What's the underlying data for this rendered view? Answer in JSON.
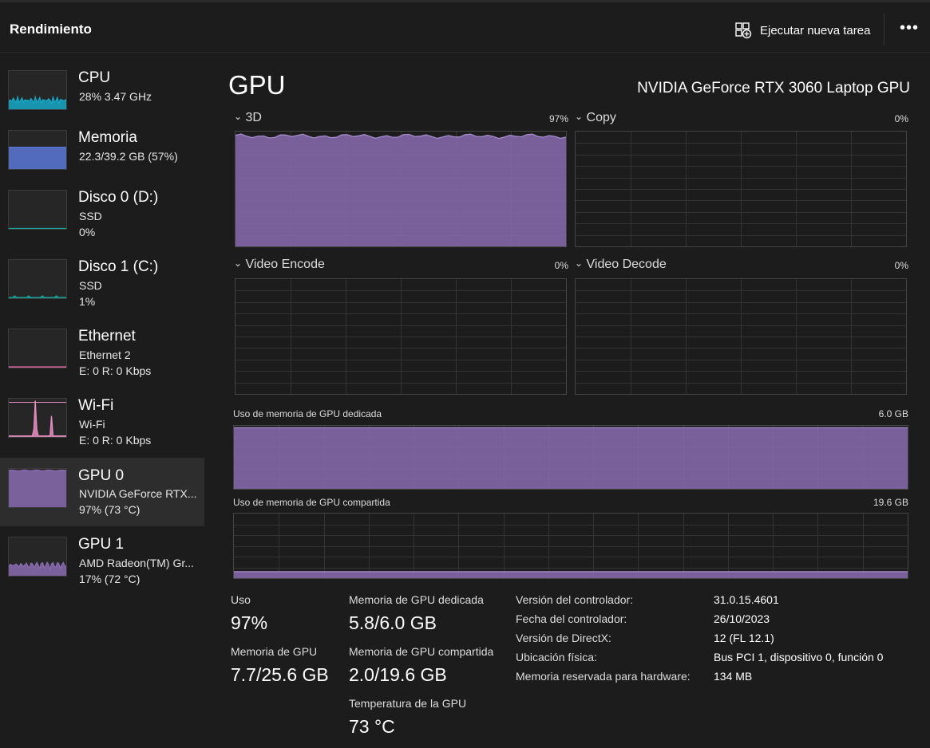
{
  "header": {
    "title": "Rendimiento",
    "new_task_label": "Ejecutar nueva tarea",
    "more_label": "•••"
  },
  "sidebar": {
    "items": [
      {
        "name": "CPU",
        "line1": "28%  3.47 GHz",
        "line2": "",
        "color": "#17a8c8"
      },
      {
        "name": "Memoria",
        "line1": "22.3/39.2 GB (57%)",
        "line2": "",
        "color": "#5b78d8"
      },
      {
        "name": "Disco 0 (D:)",
        "line1": "SSD",
        "line2": "0%",
        "color": "#1aa39a"
      },
      {
        "name": "Disco 1 (C:)",
        "line1": "SSD",
        "line2": "1%",
        "color": "#1aa39a"
      },
      {
        "name": "Ethernet",
        "line1": "Ethernet 2",
        "line2": "E: 0 R: 0 Kbps",
        "color": "#d46aa4"
      },
      {
        "name": "Wi-Fi",
        "line1": "Wi-Fi",
        "line2": "E: 0 R: 0 Kbps",
        "color": "#e48fc0"
      },
      {
        "name": "GPU 0",
        "line1": "NVIDIA GeForce RTX...",
        "line2": "97% (73 °C)",
        "color": "#8a6cb0"
      },
      {
        "name": "GPU 1",
        "line1": "AMD Radeon(TM) Gr...",
        "line2": "17% (72 °C)",
        "color": "#8a6cb0"
      }
    ],
    "selected_index": 6
  },
  "main": {
    "title": "GPU",
    "model": "NVIDIA GeForce RTX 3060 Laptop GPU",
    "engines": [
      {
        "label": "3D",
        "percent": "97%",
        "usage": 0.97
      },
      {
        "label": "Copy",
        "percent": "0%",
        "usage": 0
      },
      {
        "label": "Video Encode",
        "percent": "0%",
        "usage": 0
      },
      {
        "label": "Video Decode",
        "percent": "0%",
        "usage": 0
      }
    ],
    "dedicated_memory": {
      "label": "Uso de memoria de GPU dedicada",
      "max": "6.0 GB",
      "usage": 0.97
    },
    "shared_memory": {
      "label": "Uso de memoria de GPU compartida",
      "max": "19.6 GB",
      "usage": 0.1
    },
    "stats": {
      "usage_label": "Uso",
      "usage_value": "97%",
      "gpu_mem_label": "Memoria de GPU",
      "gpu_mem_value": "7.7/25.6 GB",
      "dedicated_label": "Memoria de GPU dedicada",
      "dedicated_value": "5.8/6.0 GB",
      "shared_label": "Memoria de GPU compartida",
      "shared_value": "2.0/19.6 GB",
      "temp_label": "Temperatura de la GPU",
      "temp_value": "73 °C"
    },
    "info": [
      {
        "key": "Versión del controlador:",
        "value": "31.0.15.4601"
      },
      {
        "key": "Fecha del controlador:",
        "value": "26/10/2023"
      },
      {
        "key": "Versión de DirectX:",
        "value": "12 (FL 12.1)"
      },
      {
        "key": "Ubicación física:",
        "value": "Bus PCI 1, dispositivo 0, función 0"
      },
      {
        "key": "Memoria reservada para hardware:",
        "value": "134 MB"
      }
    ],
    "graph_color": "#8a6cb0"
  }
}
